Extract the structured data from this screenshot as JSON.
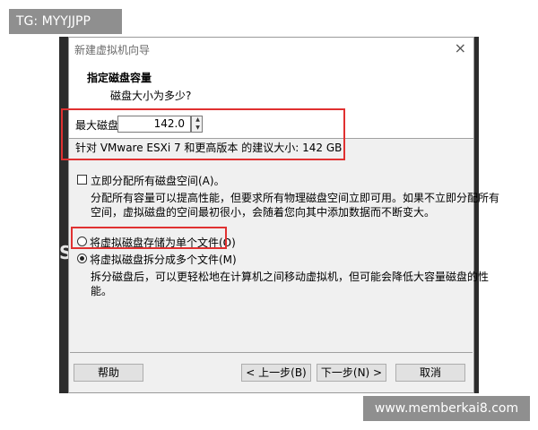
{
  "watermarks": {
    "top": "TG: MYYJJPP",
    "bottom": "www.memberkai8.com"
  },
  "background": {
    "glyph": "S"
  },
  "window": {
    "title": "新建虚拟机向导"
  },
  "header": {
    "title": "指定磁盘容量",
    "subtitle": "磁盘大小为多少?"
  },
  "max_size": {
    "label": "最大磁盘大小 (GB)(S):",
    "value": "142.0",
    "recommendation": "针对 VMware ESXi 7 和更高版本 的建议大小: 142 GB"
  },
  "allocate": {
    "label": "立即分配所有磁盘空间(A)。",
    "checked": false,
    "desc_line1": "分配所有容量可以提高性能，但要求所有物理磁盘空间立即可用。如果不立即分配所有",
    "desc_line2": "空间，虚拟磁盘的空间最初很小，会随着您向其中添加数据而不断变大。"
  },
  "options": {
    "single": {
      "label": "将虚拟磁盘存储为单个文件(O)",
      "checked": false
    },
    "multi": {
      "label": "将虚拟磁盘拆分成多个文件(M)",
      "checked": true,
      "desc_line1": "拆分磁盘后，可以更轻松地在计算机之间移动虚拟机，但可能会降低大容量磁盘的性",
      "desc_line2": "能。"
    }
  },
  "buttons": {
    "help": "帮助",
    "back": "< 上一步(B)",
    "next": "下一步(N) >",
    "cancel": "取消"
  },
  "colors": {
    "highlight": "#e03131",
    "dialog_bg": "#f0f0f0"
  }
}
